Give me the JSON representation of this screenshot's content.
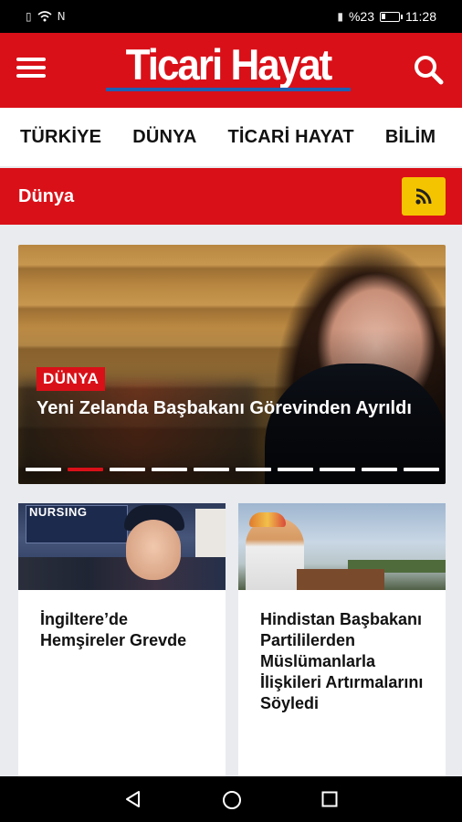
{
  "status_bar": {
    "left_icons": [
      "sim-icon",
      "wifi-icon",
      "nfc-icon"
    ],
    "vibrate_icon": "vibrate-icon",
    "battery_text": "%23",
    "battery_level": 0.23,
    "time": "11:28"
  },
  "header": {
    "logo_text": "Ticari Hayat",
    "menu_icon": "hamburger-icon",
    "search_icon": "search-icon",
    "brand_color": "#d91018",
    "logo_underline_color": "#1f5fb2"
  },
  "tabs": [
    {
      "label": "TÜRKİYE"
    },
    {
      "label": "DÜNYA"
    },
    {
      "label": "TİCARİ HAYAT"
    },
    {
      "label": "BİLİM"
    }
  ],
  "section": {
    "title": "Dünya",
    "rss_icon": "rss-icon",
    "rss_color": "#f5c400"
  },
  "hero": {
    "category": "DÜNYA",
    "title": "Yeni Zelanda Başbakanı Görevinden Ayrıldı",
    "slide_count": 10,
    "active_slide_index": 1
  },
  "articles": [
    {
      "title": "İngiltere’de Hemşireler Grevde",
      "image_sign_text": "NURSING"
    },
    {
      "title": "Hindistan Başbakanı Partililerden Müslümanlarla İlişkileri Artırmalarını Söyledi"
    }
  ],
  "nav_bar": {
    "buttons": [
      "back-icon",
      "home-icon",
      "recents-icon"
    ]
  }
}
